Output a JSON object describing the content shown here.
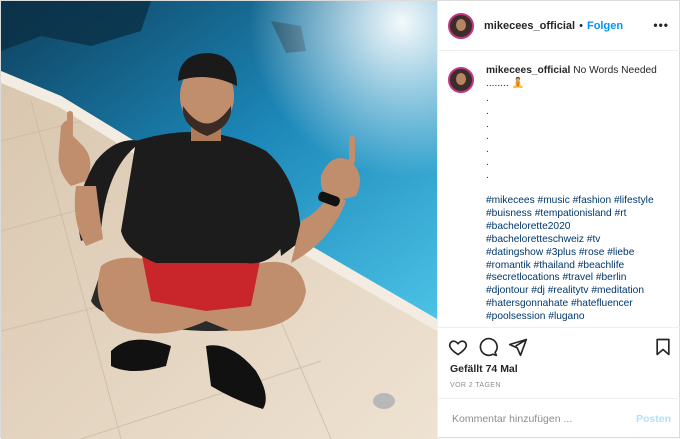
{
  "header": {
    "username": "mikecees_official",
    "separator": "•",
    "follow_label": "Folgen",
    "more_icon": "more-horizontal-icon",
    "more_label": "•••"
  },
  "caption": {
    "username": "mikecees_official",
    "text": "No Words Needed",
    "ellipsis": "........",
    "emoji": "🧘",
    "dot_lines": [
      ".",
      ".",
      ".",
      ".",
      ".",
      ".",
      "."
    ],
    "hashtags": "#mikecees #music #fashion #lifestyle #buisness #tempationisland #rt #bachelorette2020 #bacheloretteschweiz #tv #datingshow #3plus #rose #liebe #romantik #thailand #beachlife #secretlocations #travel #berlin #djontour #dj #realitytv #meditation #hatersgonnahate #hatefluencer #poolsession #lugano"
  },
  "actions": {
    "icons": [
      "heart-icon",
      "comment-icon",
      "share-icon",
      "bookmark-icon"
    ]
  },
  "likes": "Gefällt 74 Mal",
  "timestamp": "VOR 2 TAGEN",
  "comment": {
    "placeholder": "Kommentar hinzufügen ...",
    "post_label": "Posten"
  }
}
